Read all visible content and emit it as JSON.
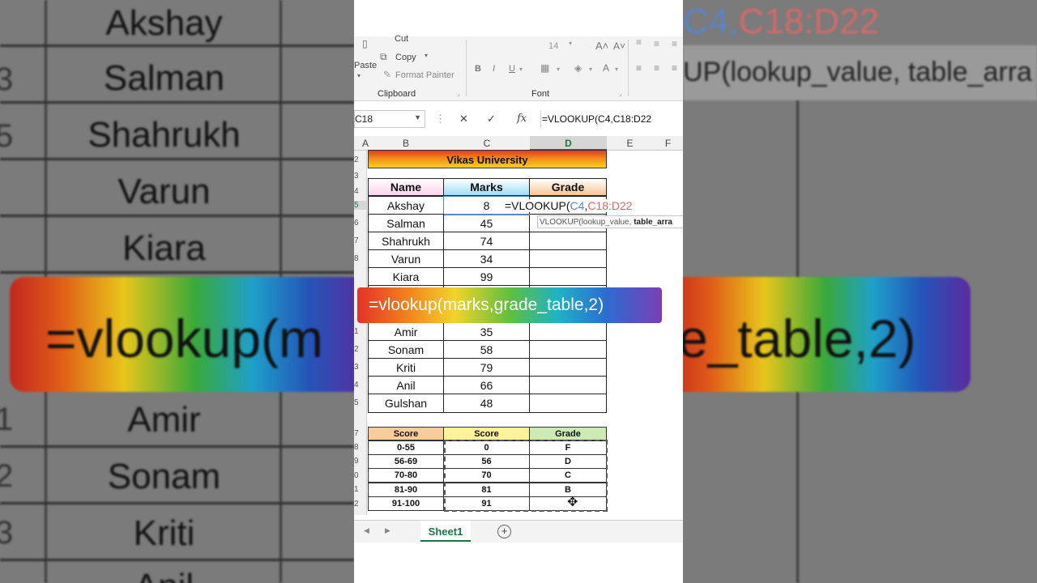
{
  "background": {
    "left_names": [
      "Akshay",
      "Salman",
      "Shahrukh",
      "Varun",
      "Kiara",
      "Amir",
      "Sonam",
      "Kriti",
      "Anil"
    ],
    "left_row_numbers": [
      "3",
      "5",
      "",
      "",
      "",
      "1",
      "2",
      "3"
    ],
    "banner_left": "=vlookup(m",
    "banner_right": "e_table,2)",
    "right_formula_top_a": "C4,",
    "right_formula_top_b": "C18:D22",
    "right_hint": "UP(lookup_value, table_arra"
  },
  "ribbon": {
    "cut_label": "Cut",
    "copy_label": "Copy",
    "paste_label": "Paste",
    "format_painter_label": "Format Painter",
    "clipboard_group": "Clipboard",
    "font_group": "Font",
    "font_size": "14",
    "bold": "B",
    "italic": "I",
    "underline": "U"
  },
  "formula_bar": {
    "name_box": "C18",
    "cancel_icon": "x-icon",
    "enter_icon": "check-icon",
    "fx_label": "fx",
    "formula": "=VLOOKUP(C4,C18:D22"
  },
  "columns": [
    "A",
    "B",
    "C",
    "D",
    "E",
    "F"
  ],
  "row_numbers": [
    "2",
    "3",
    "4",
    "5",
    "6",
    "7",
    "8",
    "",
    "",
    "1",
    "2",
    "3",
    "4",
    "5",
    "",
    "7",
    "8",
    "9",
    "0",
    "1",
    "2"
  ],
  "table": {
    "title": "Vikas University",
    "headers": [
      "Name",
      "Marks",
      "Grade"
    ],
    "rows": [
      {
        "name": "Akshay",
        "marks": "8"
      },
      {
        "name": "Salman",
        "marks": "45"
      },
      {
        "name": "Shahrukh",
        "marks": "74"
      },
      {
        "name": "Varun",
        "marks": "34"
      },
      {
        "name": "Kiara",
        "marks": "99"
      },
      {
        "name": "Amir",
        "marks": "35"
      },
      {
        "name": "Sonam",
        "marks": "58"
      },
      {
        "name": "Kriti",
        "marks": "79"
      },
      {
        "name": "Anil",
        "marks": "66"
      },
      {
        "name": "Gulshan",
        "marks": "48"
      }
    ]
  },
  "in_cell_edit": {
    "prefix": "=VLOOKUP(",
    "ref1": "C4",
    "comma": ",",
    "ref2": "C18:D22"
  },
  "tooltip": {
    "fn": "VLOOKUP(",
    "arg1": "lookup_value, ",
    "arg2": "table_arra"
  },
  "grade_table": {
    "headers": [
      "Score",
      "Score",
      "Grade"
    ],
    "rows": [
      {
        "range": "0-55",
        "score": "0",
        "grade": "F"
      },
      {
        "range": "56-69",
        "score": "56",
        "grade": "D"
      },
      {
        "range": "70-80",
        "score": "70",
        "grade": "C"
      },
      {
        "range": "81-90",
        "score": "81",
        "grade": "B"
      },
      {
        "range": "91-100",
        "score": "91",
        "grade": ""
      }
    ]
  },
  "banner": "=vlookup(marks,grade_table,2)",
  "sheets": {
    "active": "Sheet1",
    "add_icon": "plus-circle-icon"
  }
}
